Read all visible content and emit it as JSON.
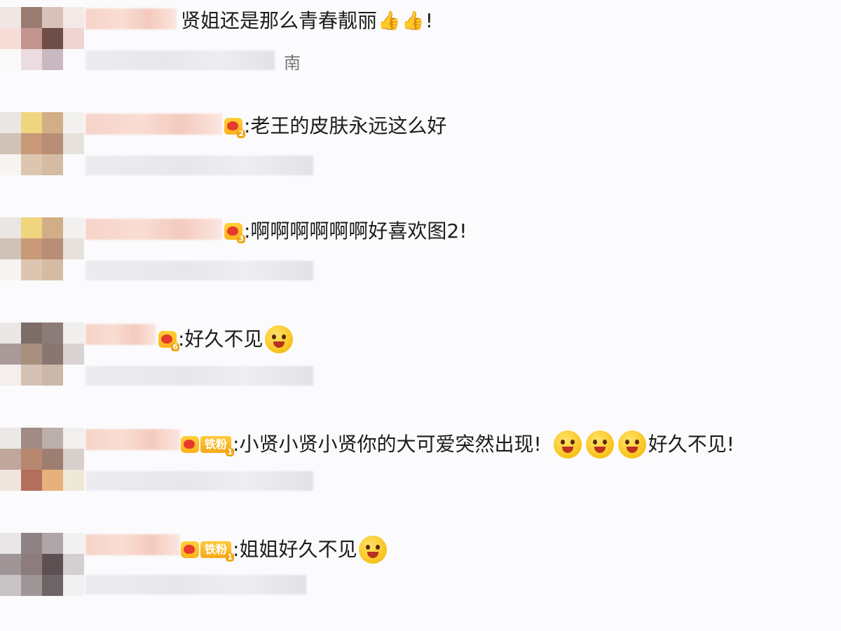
{
  "comments": [
    {
      "text": "贤姐还是那么青春靓丽",
      "suffix": "!",
      "meta": "南",
      "reactions": [
        "thumbs-up",
        "thumbs-up"
      ]
    },
    {
      "badge_level": "2",
      "text": ":老王的皮肤永远这么好"
    },
    {
      "badge_level": "3",
      "text": ":啊啊啊啊啊啊好喜欢图2!"
    },
    {
      "badge_level": "6",
      "text": ":好久不见"
    },
    {
      "badge_level": "1",
      "fan_label": "铁粉",
      "text": ":小贤小贤小贤你的大可爱突然出现!",
      "trailing_text": "好久不见!"
    },
    {
      "badge_level": "1",
      "fan_label": "铁粉",
      "text": ":姐姐好久不见"
    }
  ],
  "colors": {
    "badge_gold": "#ffb21a",
    "text": "#1c1c1c",
    "background": "#fbfbfd"
  }
}
